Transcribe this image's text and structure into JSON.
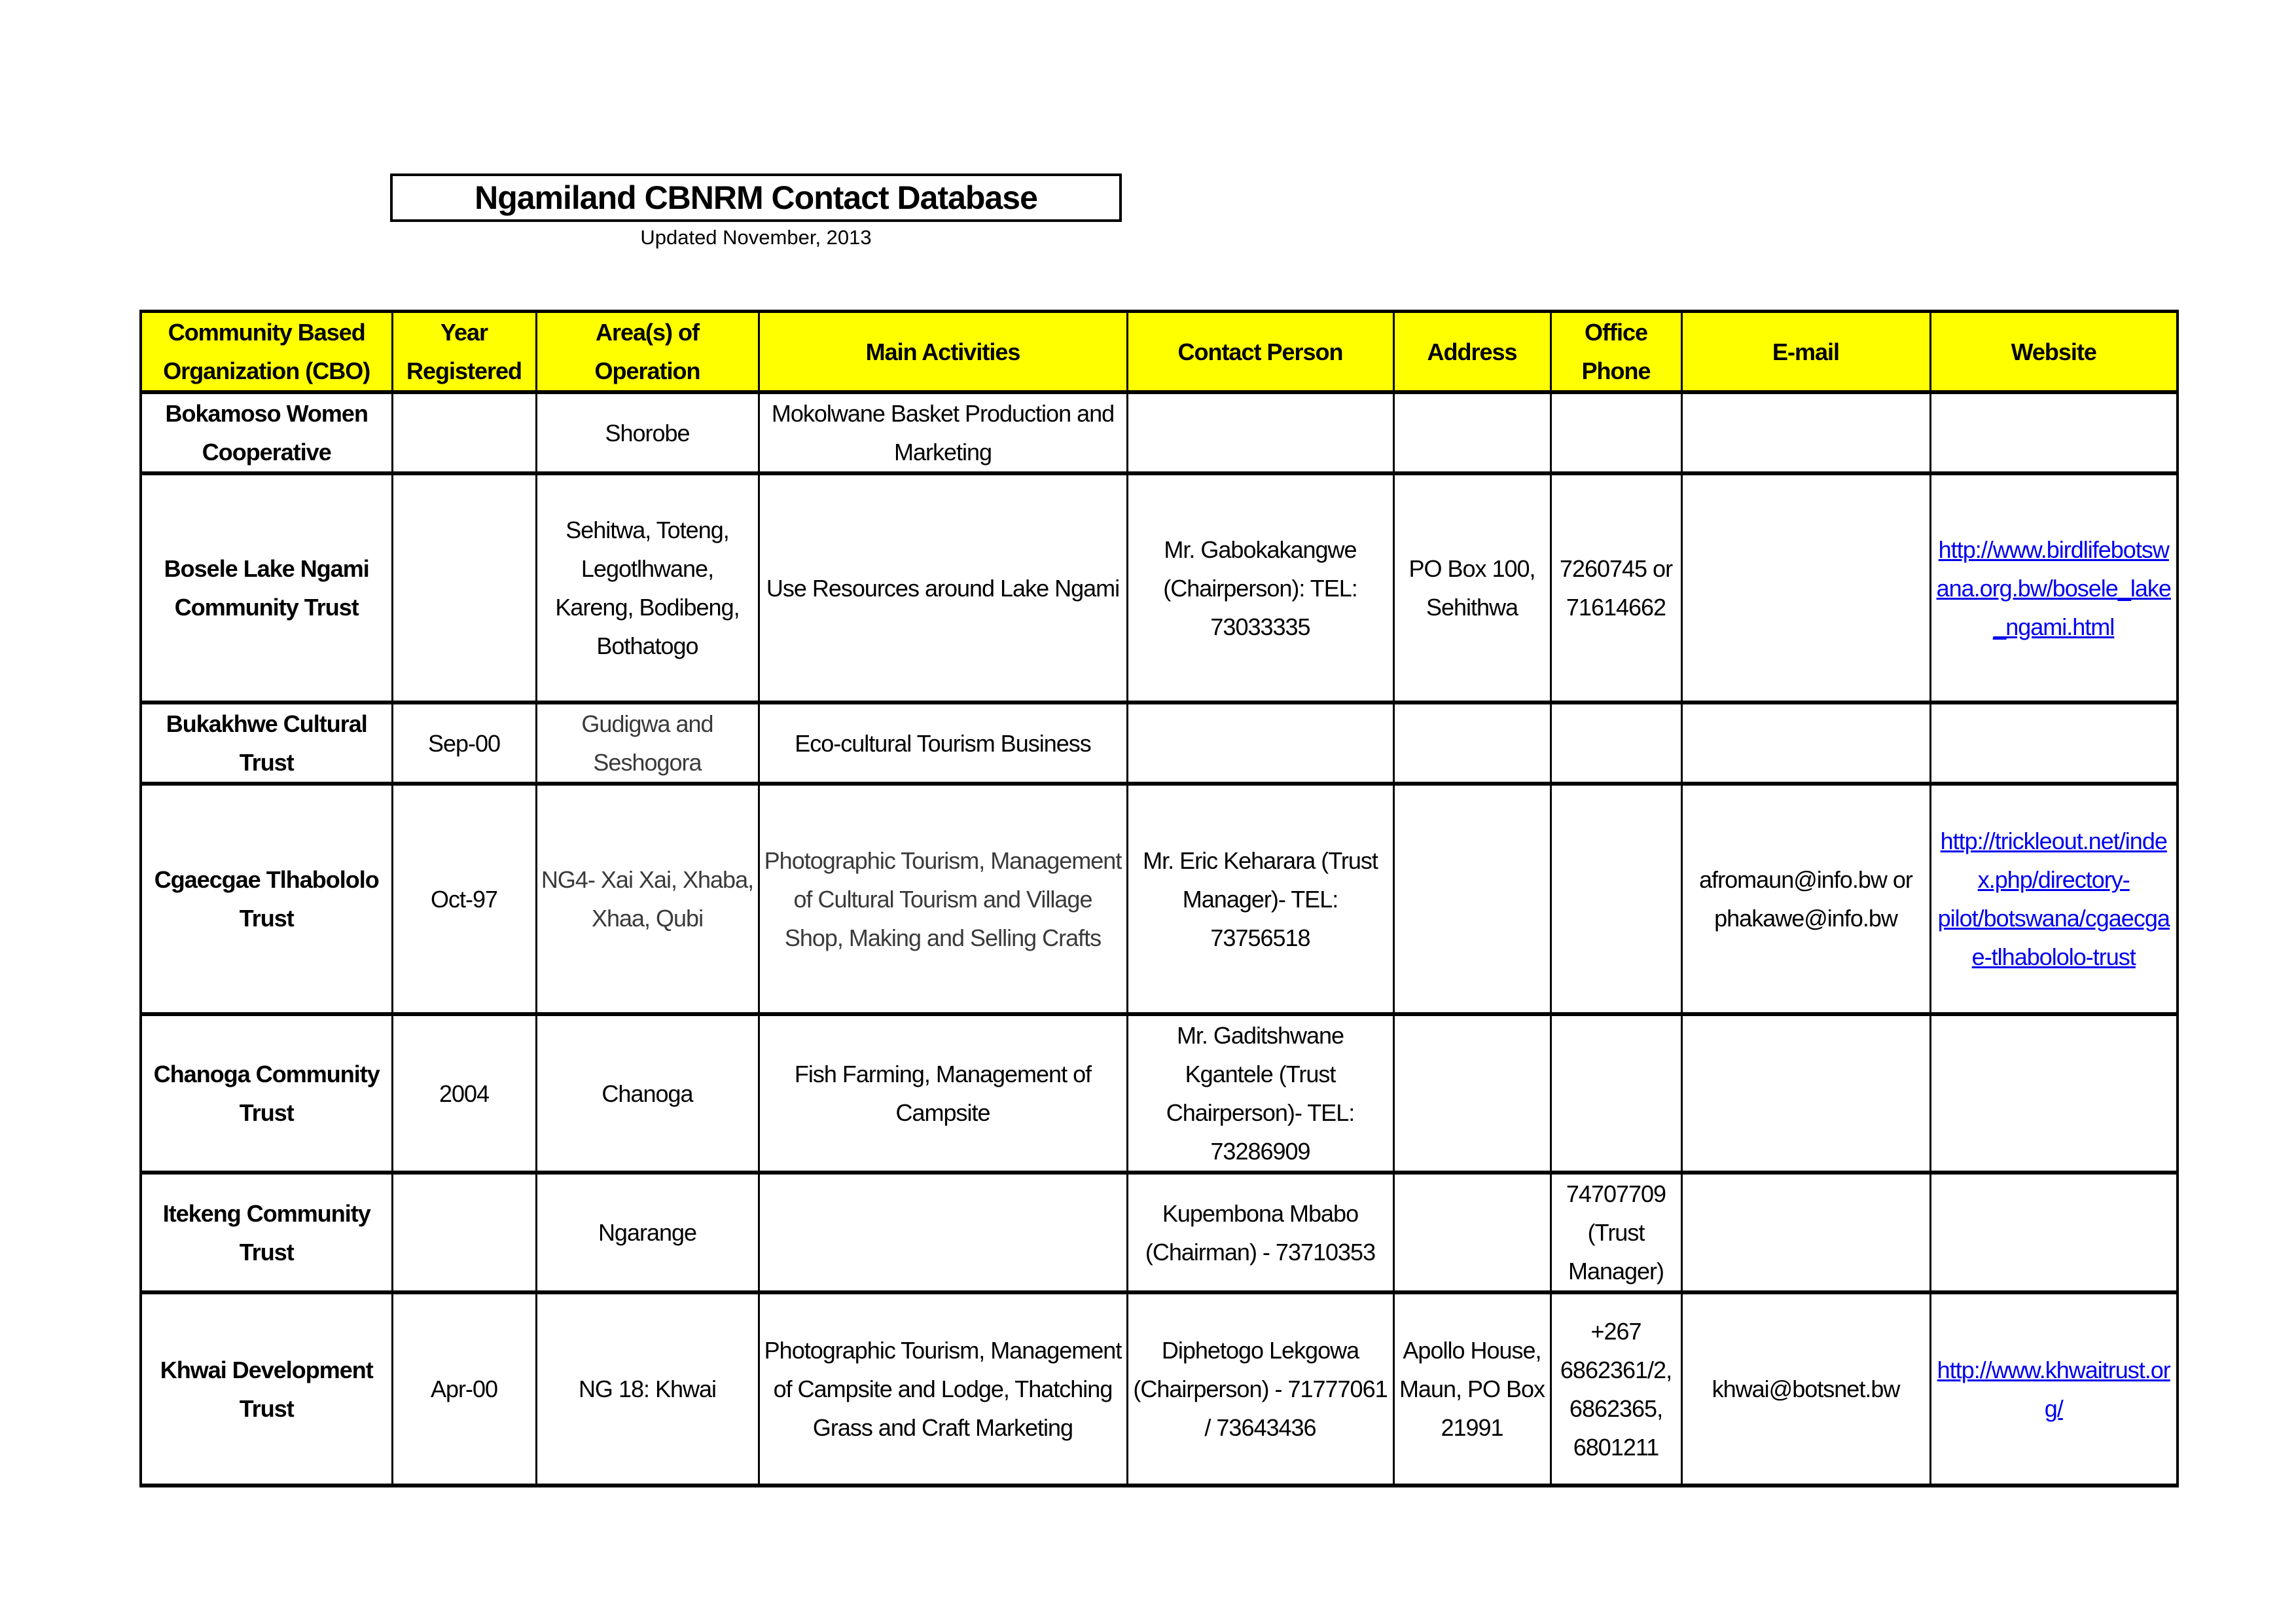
{
  "document": {
    "title": "Ngamiland CBNRM Contact Database",
    "subtitle": "Updated November, 2013"
  },
  "table": {
    "header_color": "#ffff00",
    "link_color": "#0000ee",
    "columns": [
      "Community Based Organization (CBO)",
      "Year Registered",
      "Area(s) of Operation",
      "Main Activities",
      "Contact Person",
      "Address",
      "Office Phone",
      "E-mail",
      "Website"
    ],
    "rows": [
      {
        "cbo": "Bokamoso Women Cooperative",
        "year": "",
        "area": "Shorobe",
        "activities": "Mokolwane Basket Production and Marketing",
        "contact": "",
        "address": "",
        "phone": "",
        "email": "",
        "website": ""
      },
      {
        "cbo": "Bosele Lake Ngami Community Trust",
        "year": "",
        "area": "Sehitwa, Toteng, Legotlhwane, Kareng, Bodibeng, Bothatogo",
        "activities": "Use Resources around Lake Ngami",
        "contact": "Mr. Gabokakangwe (Chairperson): TEL: 73033335",
        "address": "PO Box 100, Sehithwa",
        "phone": "7260745 or 71614662",
        "email": "",
        "website": "http://www.birdlifebotswana.org.bw/bosele_lake_ngami.html"
      },
      {
        "cbo": "Bukakhwe Cultural Trust",
        "year": "Sep-00",
        "area": "Gudigwa and Seshogora",
        "activities": "Eco-cultural Tourism Business",
        "contact": "",
        "address": "",
        "phone": "",
        "email": "",
        "website": ""
      },
      {
        "cbo": "Cgaecgae Tlhabololo Trust",
        "year": "Oct-97",
        "area": "NG4- Xai Xai, Xhaba, Xhaa, Qubi",
        "activities": "Photographic Tourism, Management of Cultural Tourism and Village Shop, Making and Selling Crafts",
        "contact": "Mr. Eric Keharara (Trust Manager)- TEL: 73756518",
        "address": "",
        "phone": "",
        "email": "afromaun@info.bw or phakawe@info.bw",
        "website": "http://trickleout.net/index.php/directory-pilot/botswana/cgaecgae-tlhabololo-trust"
      },
      {
        "cbo": "Chanoga Community Trust",
        "year": "2004",
        "area": "Chanoga",
        "activities": "Fish Farming, Management of Campsite",
        "contact": "Mr. Gaditshwane Kgantele (Trust Chairperson)- TEL: 73286909",
        "address": "",
        "phone": "",
        "email": "",
        "website": ""
      },
      {
        "cbo": "Itekeng Community Trust",
        "year": "",
        "area": "Ngarange",
        "activities": "",
        "contact": "Kupembona Mbabo (Chairman) - 73710353",
        "address": "",
        "phone": "74707709 (Trust Manager)",
        "email": "",
        "website": ""
      },
      {
        "cbo": "Khwai Development Trust",
        "year": "Apr-00",
        "area": "NG 18: Khwai",
        "activities": "Photographic Tourism, Management of Campsite and Lodge, Thatching Grass and Craft Marketing",
        "contact": "Diphetogo Lekgowa (Chairperson) - 71777061 / 73643436",
        "address": "Apollo House, Maun, PO Box 21991",
        "phone": "+267 6862361/2, 6862365, 6801211",
        "email": "khwai@botsnet.bw",
        "website": "http://www.khwaitrust.org/"
      }
    ]
  }
}
